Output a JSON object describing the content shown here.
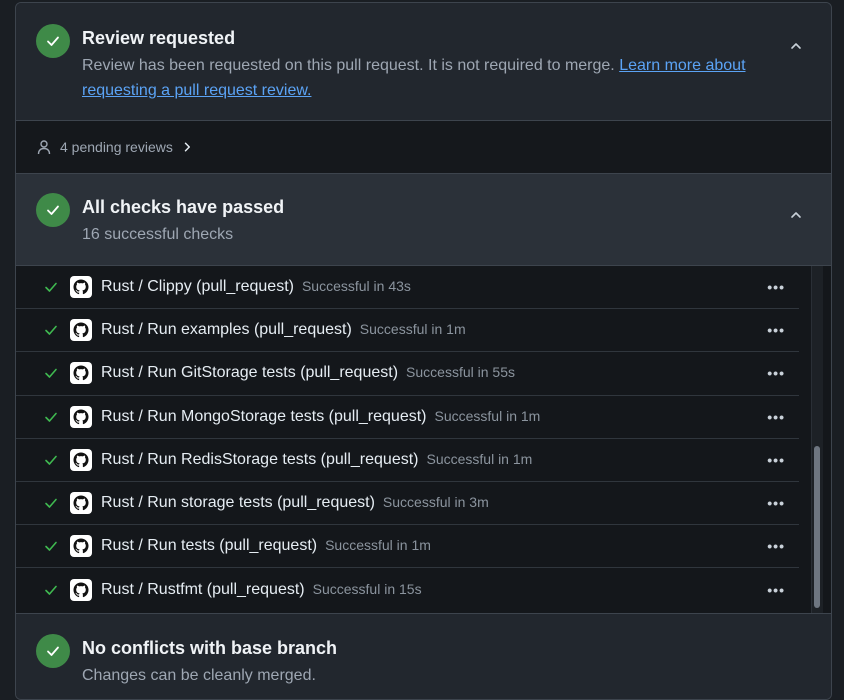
{
  "review": {
    "title": "Review requested",
    "description": "Review has been requested on this pull request. It is not required to merge.",
    "link_text": "Learn more about requesting a pull request review."
  },
  "pending": {
    "label": "4 pending reviews",
    "icon": "person-icon"
  },
  "checks": {
    "title": "All checks have passed",
    "subtitle": "16 successful checks",
    "items": [
      {
        "name": "Rust / Clippy (pull_request)",
        "status": "Successful in 43s"
      },
      {
        "name": "Rust / Run examples (pull_request)",
        "status": "Successful in 1m"
      },
      {
        "name": "Rust / Run GitStorage tests (pull_request)",
        "status": "Successful in 55s"
      },
      {
        "name": "Rust / Run MongoStorage tests (pull_request)",
        "status": "Successful in 1m"
      },
      {
        "name": "Rust / Run RedisStorage tests (pull_request)",
        "status": "Successful in 1m"
      },
      {
        "name": "Rust / Run storage tests (pull_request)",
        "status": "Successful in 3m"
      },
      {
        "name": "Rust / Run tests (pull_request)",
        "status": "Successful in 1m"
      },
      {
        "name": "Rust / Rustfmt (pull_request)",
        "status": "Successful in 15s"
      }
    ],
    "more_label": "•••"
  },
  "conflicts": {
    "title": "No conflicts with base branch",
    "description": "Changes can be cleanly merged."
  },
  "colors": {
    "success": "#3f8a48",
    "link": "#5ba3f5",
    "background": "#22272e"
  }
}
